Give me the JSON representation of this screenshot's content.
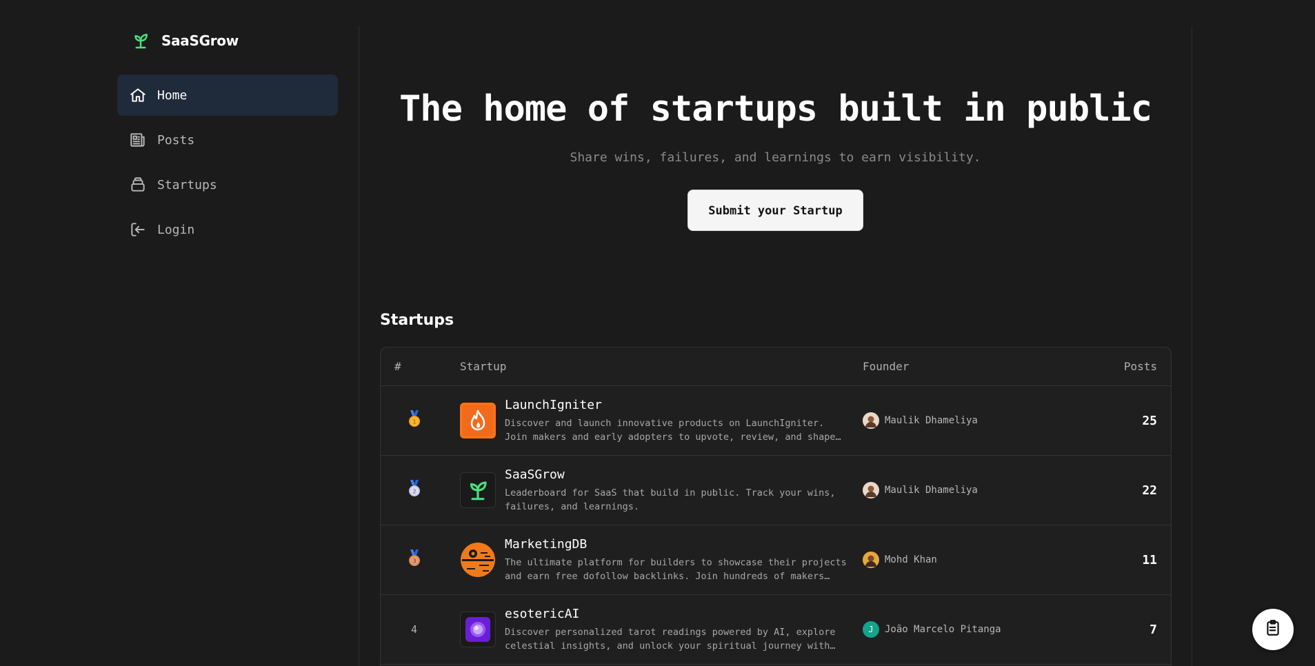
{
  "brand": {
    "name": "SaaSGrow",
    "icon": "sprout-icon",
    "accent": "#4ade80"
  },
  "nav": {
    "items": [
      {
        "label": "Home",
        "icon": "home-icon",
        "active": true
      },
      {
        "label": "Posts",
        "icon": "newspaper-icon",
        "active": false
      },
      {
        "label": "Startups",
        "icon": "stack-icon",
        "active": false
      },
      {
        "label": "Login",
        "icon": "login-icon",
        "active": false
      }
    ]
  },
  "hero": {
    "title": "The home of startups built in public",
    "subtitle": "Share wins, failures, and learnings to earn visibility.",
    "cta_label": "Submit your Startup"
  },
  "startups": {
    "section_title": "Startups",
    "headers": {
      "rank": "#",
      "startup": "Startup",
      "founder": "Founder",
      "posts": "Posts"
    },
    "rows": [
      {
        "rank": "1",
        "rank_badge": "gold-medal-icon",
        "name": "LaunchIgniter",
        "description": "Discover and launch innovative products on LaunchIgniter. Join makers and early adopters to upvote, review, and shape the next generation of products.",
        "founder": "Maulik Dhameliya",
        "posts": "25",
        "logo": "flame-icon"
      },
      {
        "rank": "2",
        "rank_badge": "silver-medal-icon",
        "name": "SaaSGrow",
        "description": "Leaderboard for SaaS that build in public. Track your wins, failures, and learnings.",
        "founder": "Maulik Dhameliya",
        "posts": "22",
        "logo": "sprout-icon"
      },
      {
        "rank": "3",
        "rank_badge": "bronze-medal-icon",
        "name": "MarketingDB",
        "description": "The ultimate platform for builders to showcase their projects and earn free dofollow backlinks. Join hundreds of makers sharing their work.",
        "founder": "Mohd Khan",
        "posts": "11",
        "logo": "death-star-icon"
      },
      {
        "rank": "4",
        "rank_badge": "",
        "name": "esotericAI",
        "description": "Discover personalized tarot readings powered by AI, explore celestial insights, and unlock your spiritual journey with ancient wisdom.",
        "founder": "João Marcelo Pitanga",
        "founder_initial": "J",
        "posts": "7",
        "logo": "orb-icon"
      }
    ]
  },
  "fab": {
    "icon": "clipboard-icon"
  }
}
